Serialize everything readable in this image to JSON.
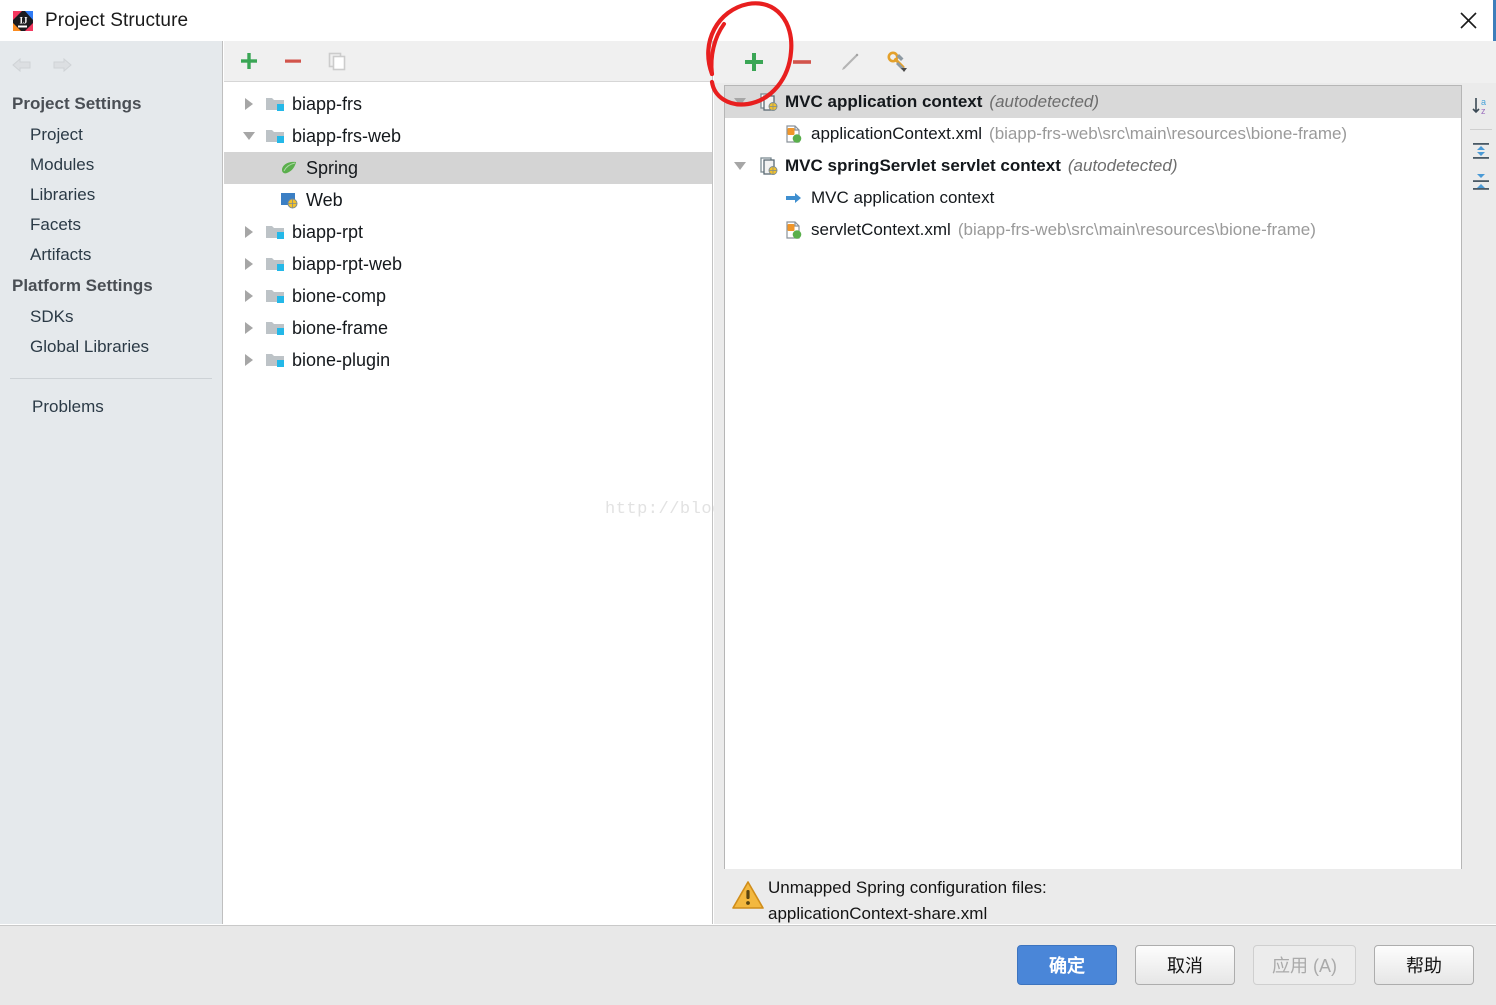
{
  "window": {
    "title": "Project Structure",
    "logo_icon": "intellij-idea-logo",
    "close_icon": "close-icon"
  },
  "navigation": {
    "back_icon": "arrow-left-icon",
    "forward_icon": "arrow-right-icon"
  },
  "sidebar": {
    "groups": [
      {
        "title": "Project Settings",
        "items": [
          {
            "label": "Project"
          },
          {
            "label": "Modules"
          },
          {
            "label": "Libraries"
          },
          {
            "label": "Facets"
          },
          {
            "label": "Artifacts"
          }
        ]
      },
      {
        "title": "Platform Settings",
        "items": [
          {
            "label": "SDKs"
          },
          {
            "label": "Global Libraries"
          }
        ]
      }
    ],
    "problems": {
      "label": "Problems"
    }
  },
  "modules_panel": {
    "toolbar": [
      {
        "name": "add-module-button",
        "icon": "plus-icon"
      },
      {
        "name": "remove-module-button",
        "icon": "minus-icon"
      },
      {
        "name": "copy-module-button",
        "icon": "copy-icon"
      }
    ],
    "tree": [
      {
        "label": "biapp-frs",
        "icon": "module-folder-icon",
        "expanded": false,
        "level": 1,
        "selected": false
      },
      {
        "label": "biapp-frs-web",
        "icon": "module-folder-icon",
        "expanded": true,
        "level": 1,
        "selected": false
      },
      {
        "label": "Spring",
        "icon": "spring-leaf-icon",
        "expanded": null,
        "level": 2,
        "selected": true
      },
      {
        "label": "Web",
        "icon": "web-facet-icon",
        "expanded": null,
        "level": 2,
        "selected": false
      },
      {
        "label": "biapp-rpt",
        "icon": "module-folder-icon",
        "expanded": false,
        "level": 1,
        "selected": false
      },
      {
        "label": "biapp-rpt-web",
        "icon": "module-folder-icon",
        "expanded": false,
        "level": 1,
        "selected": false
      },
      {
        "label": "bione-comp",
        "icon": "module-folder-icon",
        "expanded": false,
        "level": 1,
        "selected": false
      },
      {
        "label": "bione-frame",
        "icon": "module-folder-icon",
        "expanded": false,
        "level": 1,
        "selected": false
      },
      {
        "label": "bione-plugin",
        "icon": "module-folder-icon",
        "expanded": false,
        "level": 1,
        "selected": false
      }
    ]
  },
  "facet_panel": {
    "toolbar": [
      {
        "name": "add-context-button",
        "icon": "plus-icon"
      },
      {
        "name": "remove-context-button",
        "icon": "minus-icon"
      },
      {
        "name": "edit-context-button",
        "icon": "pencil-icon"
      },
      {
        "name": "configure-button",
        "icon": "wrench-dropdown-icon"
      }
    ],
    "side_toolbar": [
      {
        "name": "sort-alphabetically-button",
        "icon": "sort-az-icon"
      },
      {
        "name": "expand-all-button",
        "icon": "expand-all-icon"
      },
      {
        "name": "collapse-all-button",
        "icon": "collapse-all-icon"
      }
    ],
    "tree": [
      {
        "label": "MVC application context",
        "suffix": "(autodetected)",
        "icon": "spring-context-icon",
        "bold": true,
        "expanded": true,
        "indent": false,
        "selected": true,
        "path": ""
      },
      {
        "label": "applicationContext.xml",
        "suffix": "",
        "icon": "spring-xml-file-icon",
        "bold": false,
        "expanded": null,
        "indent": true,
        "selected": false,
        "path": "(biapp-frs-web\\src\\main\\resources\\bione-frame)"
      },
      {
        "label": "MVC springServlet servlet context",
        "suffix": "(autodetected)",
        "icon": "spring-context-icon",
        "bold": true,
        "expanded": true,
        "indent": false,
        "selected": false,
        "path": ""
      },
      {
        "label": "MVC application context",
        "suffix": "",
        "icon": "parent-context-arrow-icon",
        "bold": false,
        "expanded": null,
        "indent": true,
        "selected": false,
        "path": ""
      },
      {
        "label": "servletContext.xml",
        "suffix": "",
        "icon": "spring-xml-file-icon",
        "bold": false,
        "expanded": null,
        "indent": true,
        "selected": false,
        "path": "(biapp-frs-web\\src\\main\\resources\\bione-frame)"
      }
    ],
    "warning": {
      "icon": "warning-triangle-icon",
      "line1": "Unmapped Spring configuration files:",
      "line2": "applicationContext-share.xml"
    }
  },
  "watermark": {
    "text": "http://blog.csdn.net/flyingnet"
  },
  "annotation": {
    "shape": "hand-drawn-red-circle",
    "color": "#e81f1f"
  },
  "buttons": {
    "ok": "确定",
    "cancel": "取消",
    "apply": "应用 (A)",
    "help": "帮助"
  },
  "colors": {
    "accent": "#4a86d8",
    "sidebar_bg": "#e5e9ec",
    "toolbar_bg": "#f0f0f0",
    "selection": "#d4d4d4",
    "annotation_red": "#e81f1f",
    "warning_amber": "#f0a732"
  }
}
